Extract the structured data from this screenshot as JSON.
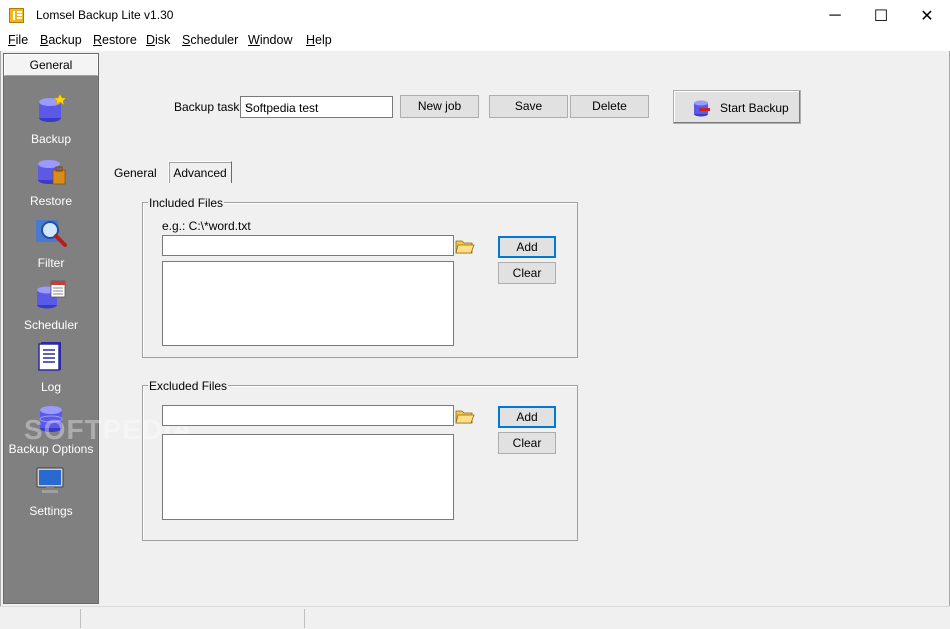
{
  "window": {
    "title": "Lomsel Backup Lite v1.30",
    "controls": {
      "minimize": "─",
      "maximize": "☐",
      "close": "✕"
    }
  },
  "menu": [
    "File",
    "Backup",
    "Restore",
    "Disk",
    "Scheduler",
    "Window",
    "Help"
  ],
  "sidebar": {
    "header": "General",
    "items": [
      {
        "label": "Backup",
        "icon": "backup-icon"
      },
      {
        "label": "Restore",
        "icon": "restore-icon"
      },
      {
        "label": "Filter",
        "icon": "filter-icon"
      },
      {
        "label": "Scheduler",
        "icon": "scheduler-icon"
      },
      {
        "label": "Log",
        "icon": "log-icon"
      },
      {
        "label": "Backup Options",
        "icon": "backup-options-icon"
      },
      {
        "label": "Settings",
        "icon": "settings-icon"
      }
    ]
  },
  "toolbar": {
    "task_label": "Backup task:",
    "task_value": "Softpedia test",
    "new_job": "New job",
    "save": "Save",
    "delete": "Delete",
    "start_backup": "Start Backup"
  },
  "tabs": {
    "general": "General",
    "advanced": "Advanced"
  },
  "included": {
    "title": "Included Files",
    "example": "e.g.:  C:\\*word.txt",
    "input_value": "",
    "add": "Add",
    "clear": "Clear"
  },
  "excluded": {
    "title": "Excluded Files",
    "input_value": "",
    "add": "Add",
    "clear": "Clear"
  },
  "watermark": "SOFTPEDIA",
  "colors": {
    "accent": "#0078d7",
    "sidebar": "#808080",
    "background": "#f0f0f0"
  }
}
